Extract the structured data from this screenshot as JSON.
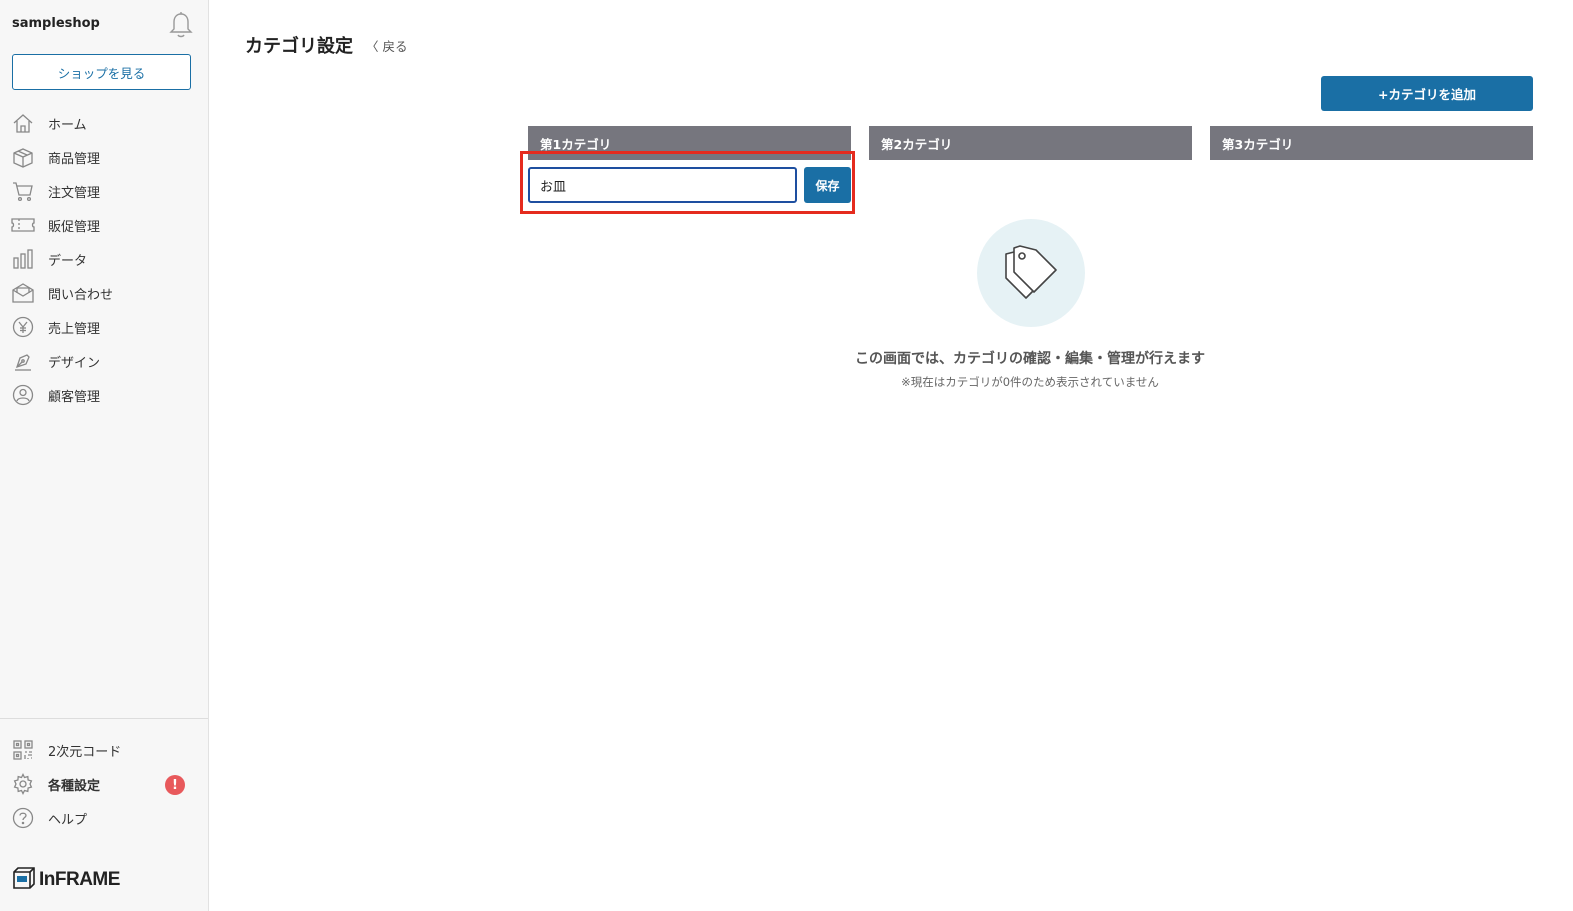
{
  "sidebar": {
    "shop_name": "sampleshop",
    "shop_button": "ショップを見る",
    "items": [
      {
        "label": "ホーム",
        "icon": "home-icon"
      },
      {
        "label": "商品管理",
        "icon": "box-icon"
      },
      {
        "label": "注文管理",
        "icon": "cart-icon"
      },
      {
        "label": "販促管理",
        "icon": "ticket-icon"
      },
      {
        "label": "データ",
        "icon": "bar-chart-icon"
      },
      {
        "label": "問い合わせ",
        "icon": "envelope-icon"
      },
      {
        "label": "売上管理",
        "icon": "yen-icon"
      },
      {
        "label": "デザイン",
        "icon": "pen-icon"
      },
      {
        "label": "顧客管理",
        "icon": "user-icon"
      }
    ],
    "bottom_items": [
      {
        "label": "2次元コード",
        "icon": "qr-code-icon"
      },
      {
        "label": "各種設定",
        "icon": "gear-icon",
        "alert": "!"
      },
      {
        "label": "ヘルプ",
        "icon": "help-icon"
      }
    ],
    "logo_text": "InFRAME"
  },
  "main": {
    "title": "カテゴリ設定",
    "back_label": "〈 戻る",
    "add_button": "+カテゴリを追加",
    "columns": [
      "第1カテゴリ",
      "第2カテゴリ",
      "第3カテゴリ"
    ],
    "input_value": "お皿",
    "save_button": "保存",
    "empty_title": "この画面では、カテゴリの確認・編集・管理が行えます",
    "empty_note": "※現在はカテゴリが0件のため表示されていません"
  },
  "colors": {
    "primary": "#1a6fa5",
    "header_gray": "#76767e",
    "highlight_red": "#e52b1e",
    "alert_red": "#e8595c"
  }
}
